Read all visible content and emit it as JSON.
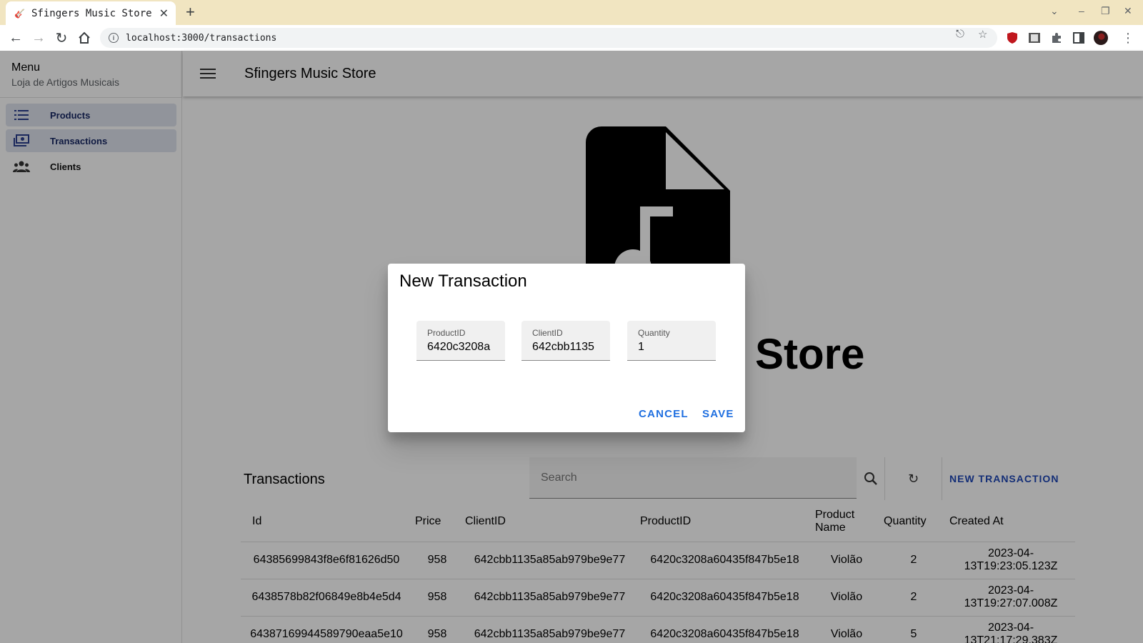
{
  "browser": {
    "tab_title": "Sfingers Music Store",
    "tab_favicon": "🎸",
    "url": "localhost:3000/transactions"
  },
  "drawer": {
    "title": "Menu",
    "subtitle": "Loja de Artigos Musicais",
    "items": [
      {
        "label": "Products",
        "icon": "list-icon"
      },
      {
        "label": "Transactions",
        "icon": "money-icon"
      },
      {
        "label": "Clients",
        "icon": "people-icon"
      }
    ]
  },
  "appbar": {
    "title": "Sfingers Music Store"
  },
  "hero": {
    "text": "Store"
  },
  "table": {
    "title": "Transactions",
    "search_placeholder": "Search",
    "new_button": "NEW TRANSACTION",
    "columns": [
      "Id",
      "Price",
      "ClientID",
      "ProductID",
      "Product Name",
      "Quantity",
      "Created At"
    ],
    "rows": [
      [
        "64385699843f8e6f81626d50",
        "958",
        "642cbb1135a85ab979be9e77",
        "6420c3208a60435f847b5e18",
        "Violão",
        "2",
        "2023-04-13T19:23:05.123Z"
      ],
      [
        "6438578b82f06849e8b4e5d4",
        "958",
        "642cbb1135a85ab979be9e77",
        "6420c3208a60435f847b5e18",
        "Violão",
        "2",
        "2023-04-13T19:27:07.008Z"
      ],
      [
        "64387169944589790eaa5e10",
        "958",
        "642cbb1135a85ab979be9e77",
        "6420c3208a60435f847b5e18",
        "Violão",
        "5",
        "2023-04-13T21:17:29.383Z"
      ]
    ]
  },
  "dialog": {
    "title": "New Transaction",
    "fields": [
      {
        "label": "ProductID",
        "value": "6420c3208a"
      },
      {
        "label": "ClientID",
        "value": "642cbb1135"
      },
      {
        "label": "Quantity",
        "value": "1"
      }
    ],
    "cancel_label": "CANCEL",
    "save_label": "SAVE"
  }
}
